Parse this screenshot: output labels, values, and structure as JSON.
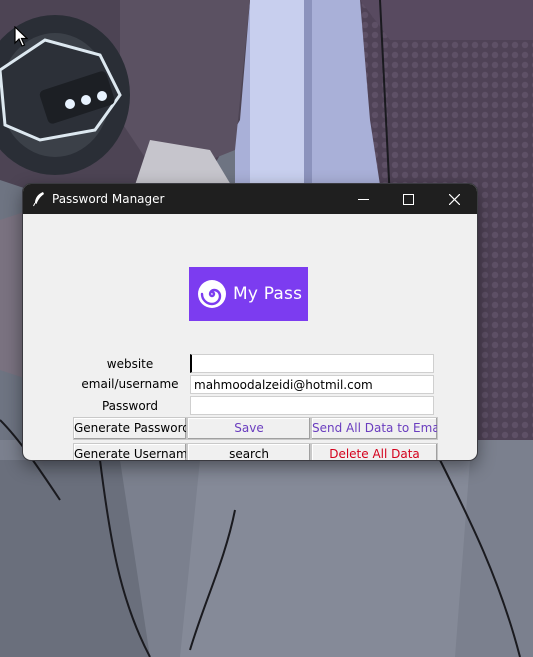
{
  "window": {
    "title": "Password Manager"
  },
  "logo": {
    "text": "My Pass",
    "background": "#7c3cf0",
    "icon": "spiral-icon"
  },
  "form": {
    "website_label": "website",
    "website_value": "",
    "email_label": "email/username",
    "email_value": "mahmoodalzeidi@hotmil.com",
    "password_label": "Password",
    "password_value": ""
  },
  "buttons": {
    "generate_password": "Generate Password",
    "save": "Save",
    "send_all": "Send All Data to Email",
    "generate_username": "Generate Username",
    "search": "search",
    "delete_all": "Delete All Data"
  },
  "colors": {
    "titlebar": "#1f1f1f",
    "client_bg": "#f0f0f0",
    "accent_text": "#6a3dbf",
    "danger_text": "#d4001c"
  }
}
